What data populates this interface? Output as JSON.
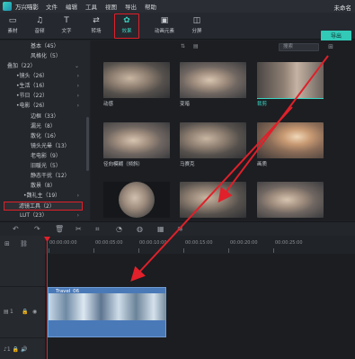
{
  "app": {
    "name": "万兴喵影",
    "project_name": "未命名"
  },
  "menu": [
    "文件",
    "编辑",
    "工具",
    "视图",
    "导出",
    "帮助"
  ],
  "toolbar": {
    "tools": [
      {
        "label": "素材",
        "icon": "folder-icon"
      },
      {
        "label": "音频",
        "icon": "music-icon"
      },
      {
        "label": "文字",
        "icon": "text-icon"
      },
      {
        "label": "转场",
        "icon": "transition-icon"
      },
      {
        "label": "效果",
        "icon": "effects-icon"
      },
      {
        "label": "动画元素",
        "icon": "image-icon"
      },
      {
        "label": "分屏",
        "icon": "splitscreen-icon"
      }
    ],
    "export_label": "导出"
  },
  "categories": [
    {
      "label": "基本（45）",
      "bullet": false
    },
    {
      "label": "风格化（5）",
      "bullet": false
    },
    {
      "label": "叠加（22）",
      "bullet": false
    },
    {
      "label": "•镜头（26）",
      "bullet": true
    },
    {
      "label": "•生活（16）",
      "bullet": true
    },
    {
      "label": "•节日（22）",
      "bullet": true
    },
    {
      "label": "•电影（26）",
      "bullet": true
    },
    {
      "label": "边框（33）",
      "bullet": false
    },
    {
      "label": "漏光（8）",
      "bullet": false
    },
    {
      "label": "散化（16）",
      "bullet": false
    },
    {
      "label": "镜头光晕（13）",
      "bullet": false
    },
    {
      "label": "老电影（9）",
      "bullet": false
    },
    {
      "label": "旧暖光（5）",
      "bullet": false
    },
    {
      "label": "静态干扰（12）",
      "bullet": false
    },
    {
      "label": "散景（8）",
      "bullet": false
    },
    {
      "label": "•魏礼主（19）",
      "bullet": true
    },
    {
      "label": "滤镜工具（2）",
      "bullet": false
    },
    {
      "label": "LUT（23）",
      "bullet": false
    }
  ],
  "content": {
    "search_placeholder": "搜索",
    "effects": [
      {
        "caption": "动感",
        "thumb": "img-a"
      },
      {
        "caption": "变暗",
        "thumb": "img-b"
      },
      {
        "caption": "裁剪",
        "thumb": "img-c"
      },
      {
        "caption": "径向模糊（倾斜）",
        "thumb": "img-b"
      },
      {
        "caption": "马赛克",
        "thumb": "img-a"
      },
      {
        "caption": "画质",
        "thumb": "img-d"
      },
      {
        "caption": "",
        "thumb": "circle"
      },
      {
        "caption": "",
        "thumb": "img-a"
      },
      {
        "caption": "",
        "thumb": "img-b"
      }
    ]
  },
  "timeline": {
    "ticks": [
      "00:00:00:00",
      "00:00:05:00",
      "00:00:10:00",
      "00:00:15:00",
      "00:00:20:00",
      "00:00:25:00"
    ],
    "clip_name": "Travel_06",
    "track_labels": [
      "1",
      "1"
    ]
  },
  "colors": {
    "accent": "#32c9b7",
    "highlight_box": "#e0202a",
    "clip": "#4a79b8"
  }
}
